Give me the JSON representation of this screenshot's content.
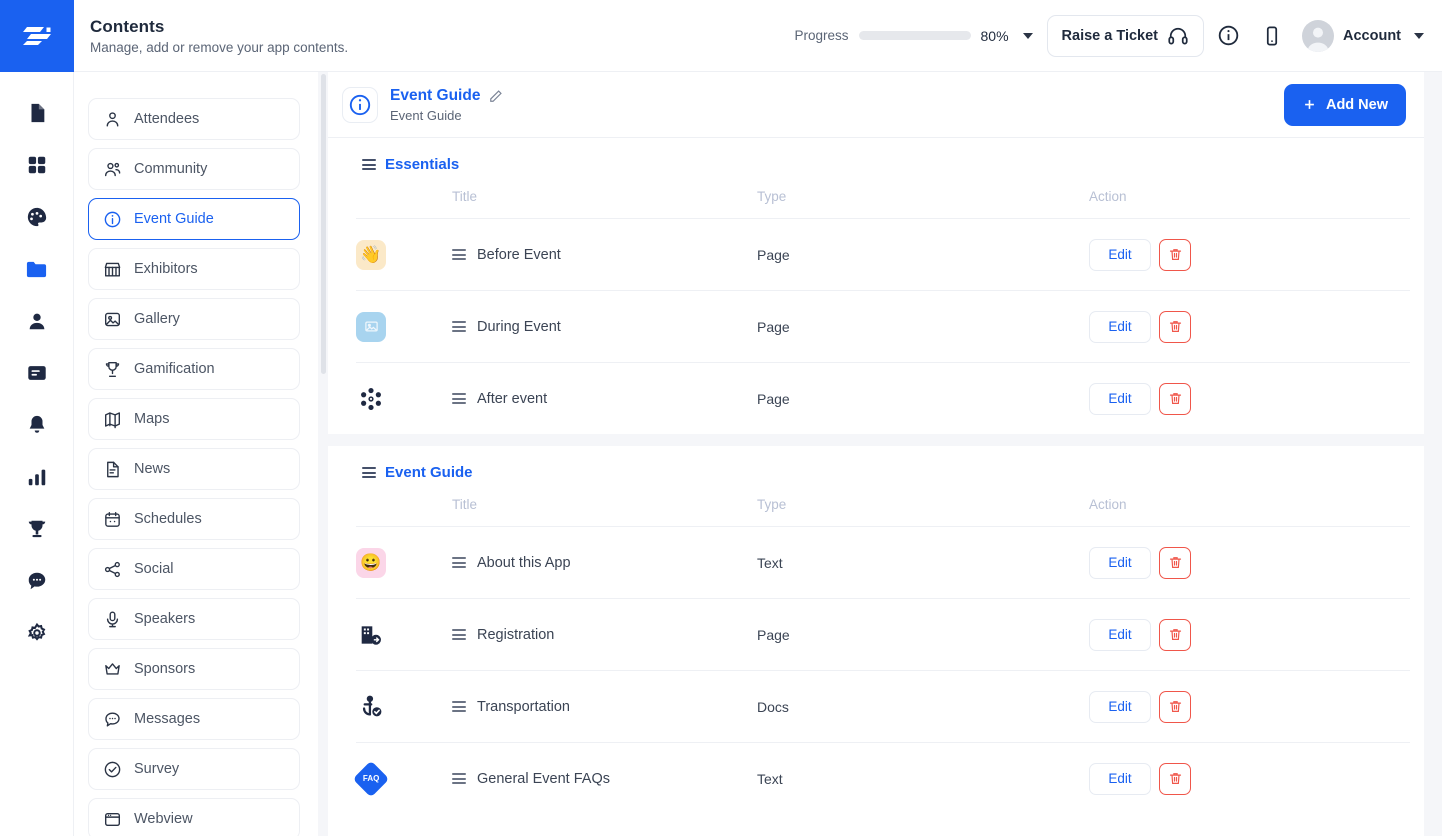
{
  "brand": {
    "logo_icon": "stacked-bars-logo",
    "accent": "#1a61f0"
  },
  "header": {
    "title": "Contents",
    "subtitle": "Manage, add or remove your app contents.",
    "progress_label": "Progress",
    "progress_value": "80%",
    "progress_percent": 80,
    "ticket_button": "Raise a Ticket",
    "ticket_icon": "headset-icon",
    "info_icon": "info-circle-icon",
    "mobile_icon": "mobile-phone-icon",
    "account_label": "Account",
    "account_avatar_icon": "user-avatar-icon",
    "dropdown_icon": "chevron-down-icon"
  },
  "rail": {
    "items": [
      {
        "icon": "document-icon",
        "active": false
      },
      {
        "icon": "grid-apps-icon",
        "active": false
      },
      {
        "icon": "palette-icon",
        "active": false
      },
      {
        "icon": "folder-icon",
        "active": true
      },
      {
        "icon": "person-icon",
        "active": false
      },
      {
        "icon": "card-text-icon",
        "active": false
      },
      {
        "icon": "bell-icon",
        "active": false
      },
      {
        "icon": "bar-chart-icon",
        "active": false
      },
      {
        "icon": "trophy-icon",
        "active": false
      },
      {
        "icon": "chat-bubble-icon",
        "active": false
      },
      {
        "icon": "gear-icon",
        "active": false
      }
    ]
  },
  "nav": {
    "items": [
      {
        "label": "Attendees",
        "icon": "user-icon",
        "active": false
      },
      {
        "label": "Community",
        "icon": "users-icon",
        "active": false
      },
      {
        "label": "Event Guide",
        "icon": "info-circle-icon",
        "active": true
      },
      {
        "label": "Exhibitors",
        "icon": "store-icon",
        "active": false
      },
      {
        "label": "Gallery",
        "icon": "image-icon",
        "active": false
      },
      {
        "label": "Gamification",
        "icon": "trophy-icon",
        "active": false
      },
      {
        "label": "Maps",
        "icon": "map-icon",
        "active": false
      },
      {
        "label": "News",
        "icon": "news-doc-icon",
        "active": false
      },
      {
        "label": "Schedules",
        "icon": "calendar-icon",
        "active": false
      },
      {
        "label": "Social",
        "icon": "share-icon",
        "active": false
      },
      {
        "label": "Speakers",
        "icon": "microphone-icon",
        "active": false
      },
      {
        "label": "Sponsors",
        "icon": "crown-icon",
        "active": false
      },
      {
        "label": "Messages",
        "icon": "chat-bubble-icon",
        "active": false
      },
      {
        "label": "Survey",
        "icon": "check-circle-icon",
        "active": false
      },
      {
        "label": "Webview",
        "icon": "browser-icon",
        "active": false
      }
    ]
  },
  "content_header": {
    "icon": "info-circle-icon",
    "title": "Event Guide",
    "subtitle": "Event Guide",
    "edit_icon": "pencil-icon",
    "add_button": "Add New",
    "add_icon": "plus-icon"
  },
  "table_columns": {
    "title": "Title",
    "type": "Type",
    "action": "Action"
  },
  "row_actions": {
    "edit": "Edit",
    "delete_icon": "trash-icon",
    "drag_icon": "drag-handle-icon"
  },
  "sections": [
    {
      "name": "Essentials",
      "rows": [
        {
          "thumb": "👋",
          "thumb_bg": "#fbe9c8",
          "thumb_kind": "emoji",
          "title": "Before Event",
          "type": "Page"
        },
        {
          "thumb": "",
          "thumb_bg": "#a8d4ef",
          "thumb_kind": "image-placeholder-icon",
          "title": "During Event",
          "type": "Page"
        },
        {
          "thumb": "",
          "thumb_bg": "transparent",
          "thumb_kind": "atom-icon",
          "title": "After event",
          "type": "Page"
        }
      ]
    },
    {
      "name": "Event Guide",
      "rows": [
        {
          "thumb": "😀",
          "thumb_bg": "#fbd6e8",
          "thumb_kind": "emoji",
          "title": "About this App",
          "type": "Text"
        },
        {
          "thumb": "",
          "thumb_bg": "transparent",
          "thumb_kind": "building-arrow-icon",
          "title": "Registration",
          "type": "Page"
        },
        {
          "thumb": "",
          "thumb_bg": "transparent",
          "thumb_kind": "anchor-check-icon",
          "title": "Transportation",
          "type": "Docs"
        },
        {
          "thumb": "FAQ",
          "thumb_bg": "transparent",
          "thumb_kind": "faq-badge-icon",
          "title": "General Event FAQs",
          "type": "Text"
        }
      ]
    }
  ]
}
